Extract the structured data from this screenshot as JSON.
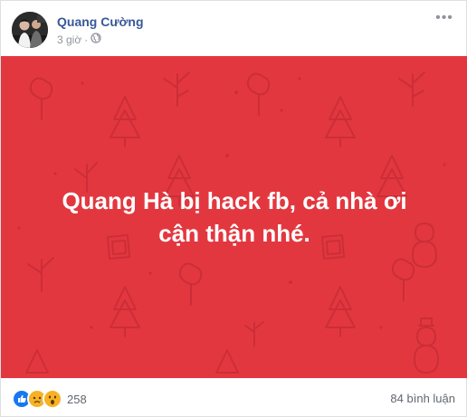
{
  "post": {
    "author": "Quang Cường",
    "time": "3 giờ",
    "privacy_icon": "globe-icon",
    "more_icon": "more-options-icon",
    "card_text_line1": "Quang Hà bị hack fb, cả nhà ơi",
    "card_text_line2": "cận thận nhé.",
    "card_background": "#e3373f",
    "reactions": [
      "like-icon",
      "sad-icon",
      "wow-icon"
    ],
    "reaction_count": "258",
    "comment_count": "84 bình luận"
  }
}
